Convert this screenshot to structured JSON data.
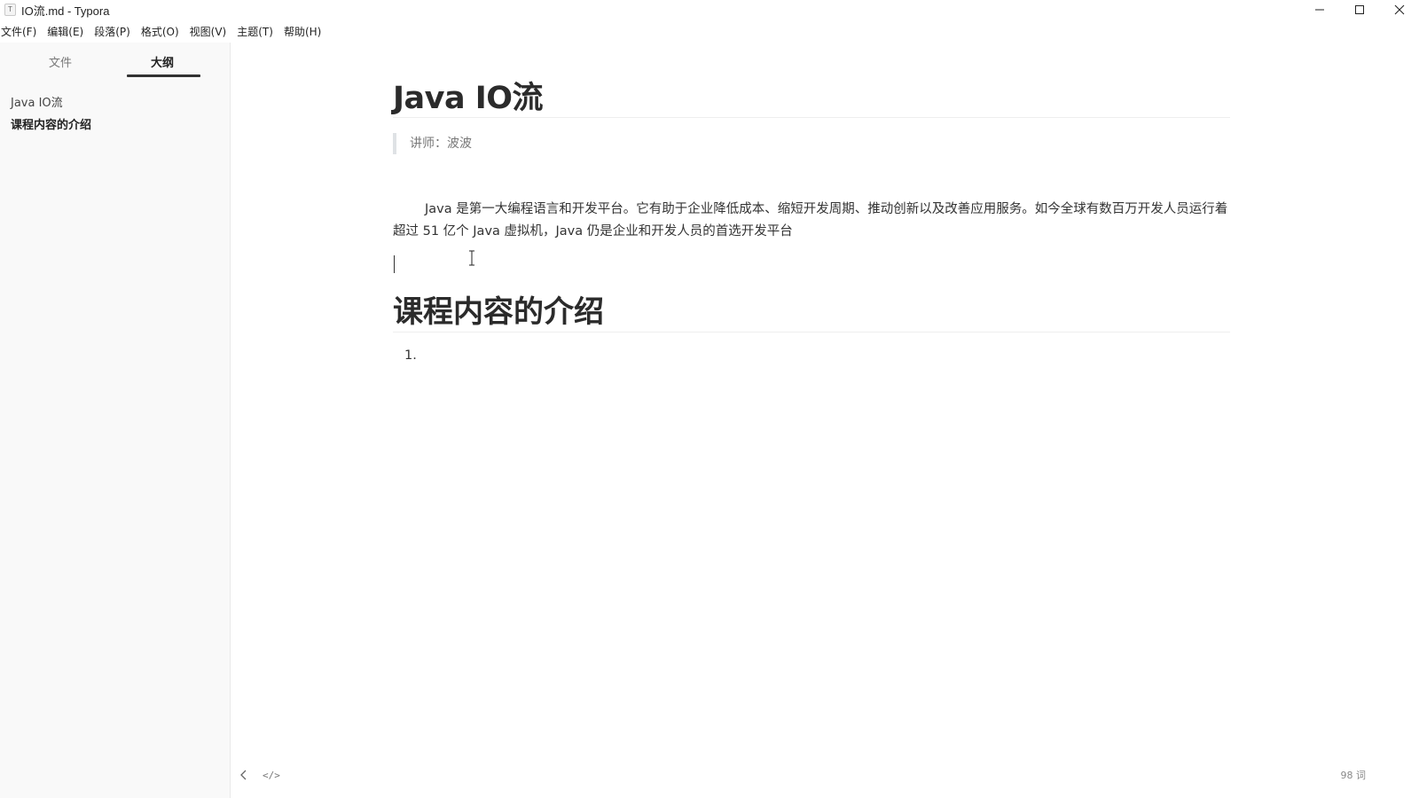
{
  "window": {
    "app_icon_letter": "T",
    "title": "IO流.md - Typora"
  },
  "menu": {
    "items": [
      "文件(F)",
      "编辑(E)",
      "段落(P)",
      "格式(O)",
      "视图(V)",
      "主题(T)",
      "帮助(H)"
    ]
  },
  "sidebar": {
    "tabs": {
      "files": "文件",
      "outline": "大纲"
    },
    "active_tab": "outline",
    "outline": [
      {
        "label": "Java IO流",
        "active": false
      },
      {
        "label": "课程内容的介绍",
        "active": true
      }
    ]
  },
  "document": {
    "title": "Java IO流",
    "quote": "讲师：波波",
    "paragraph": "Java 是第一大编程语言和开发平台。它有助于企业降低成本、缩短开发周期、推动创新以及改善应用服务。如今全球有数百万开发人员运行着超过 51 亿个 Java 虚拟机，Java 仍是企业和开发人员的首选开发平台",
    "section_heading": "课程内容的介绍",
    "list_marker": "1."
  },
  "footer": {
    "source_toggle": "</>",
    "word_count": "98 词"
  }
}
